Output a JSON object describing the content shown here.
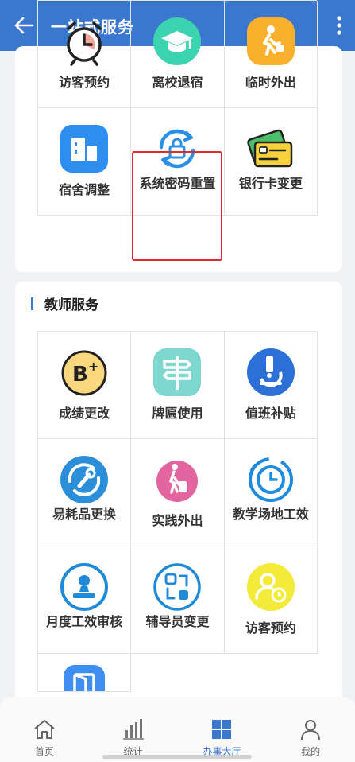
{
  "header": {
    "title": "一站式服务"
  },
  "section1": {
    "items": [
      {
        "label": "访客预约",
        "icon": "alarm-clock-icon"
      },
      {
        "label": "离校退宿",
        "icon": "graduation-cap-icon"
      },
      {
        "label": "临时外出",
        "icon": "walking-person-icon"
      },
      {
        "label": "宿舍调整",
        "icon": "building-icon"
      },
      {
        "label": "系统密码重置",
        "icon": "lock-refresh-icon"
      },
      {
        "label": "银行卡变更",
        "icon": "bank-card-icon"
      }
    ]
  },
  "section2": {
    "title": "教师服务",
    "items": [
      {
        "label": "成绩更改",
        "icon": "grade-b-plus-icon"
      },
      {
        "label": "牌匾使用",
        "icon": "signpost-icon"
      },
      {
        "label": "值班补贴",
        "icon": "microscope-icon"
      },
      {
        "label": "易耗品更换",
        "icon": "wrench-refresh-icon"
      },
      {
        "label": "实践外出",
        "icon": "traveler-icon"
      },
      {
        "label": "教学场地工效",
        "icon": "timer-icon"
      },
      {
        "label": "月度工效审核",
        "icon": "stamp-icon"
      },
      {
        "label": "辅导员变更",
        "icon": "swap-icon"
      },
      {
        "label": "访客预约",
        "icon": "visitor-clock-icon"
      },
      {
        "label": "",
        "icon": "door-icon"
      }
    ]
  },
  "tabbar": {
    "tabs": [
      {
        "label": "首页",
        "icon": "home-icon"
      },
      {
        "label": "统计",
        "icon": "bar-chart-icon"
      },
      {
        "label": "办事大厅",
        "icon": "grid-icon"
      },
      {
        "label": "我的",
        "icon": "person-icon"
      }
    ],
    "active": "办事大厅"
  },
  "colors": {
    "header": "#3a78d0",
    "highlight": "#e02b2b"
  }
}
